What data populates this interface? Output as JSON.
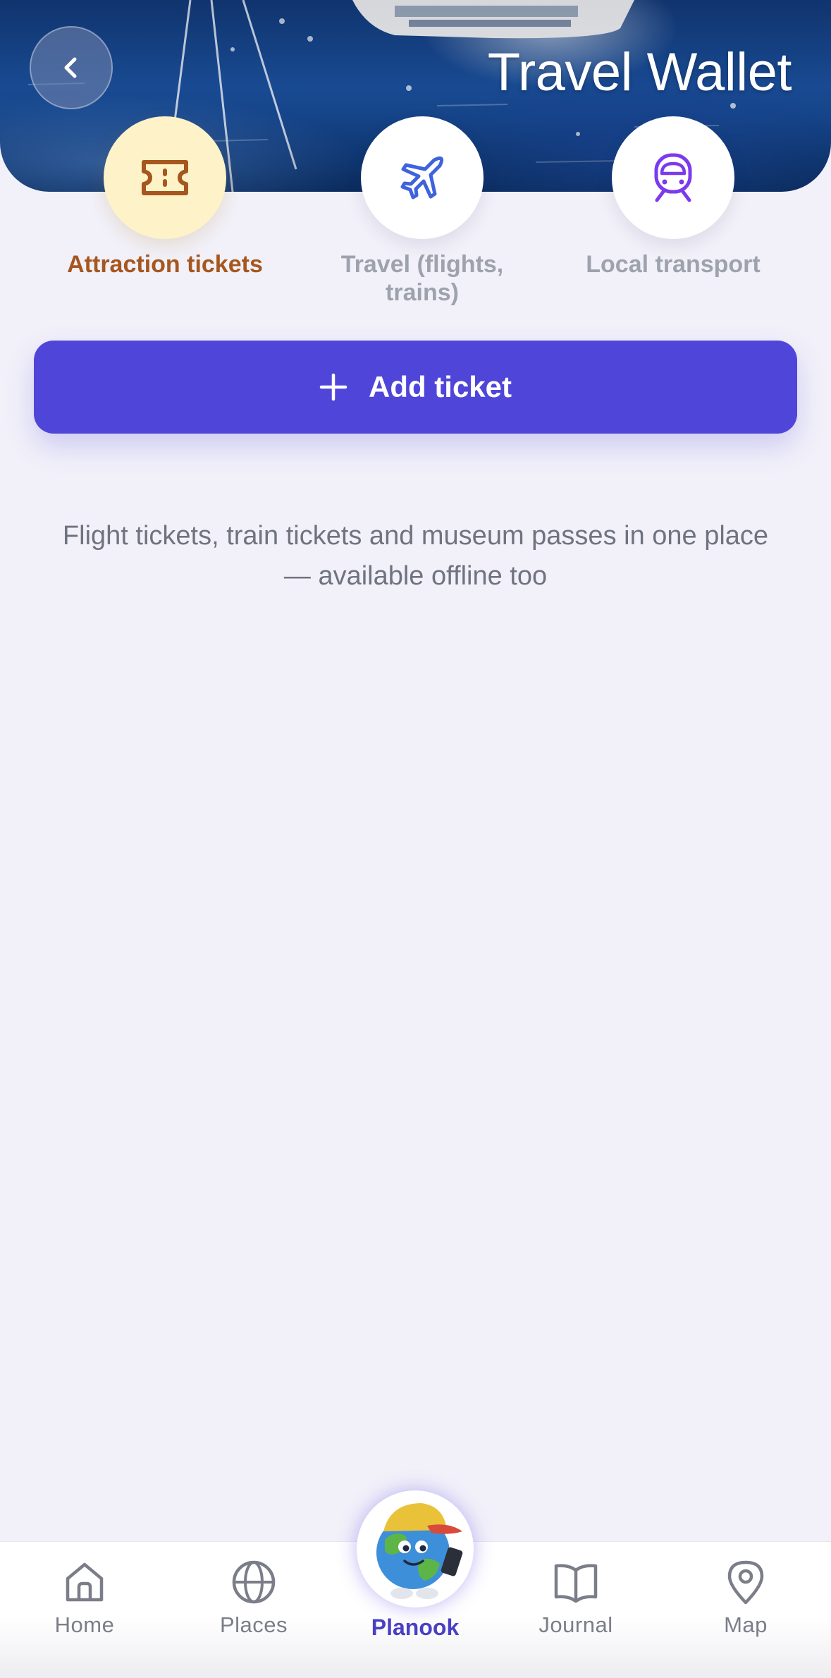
{
  "header": {
    "title": "Travel Wallet",
    "back_icon": "chevron-left-icon"
  },
  "categories": [
    {
      "label": "Attraction tickets",
      "icon": "ticket-icon",
      "active": true,
      "color": "#A6561E"
    },
    {
      "label": "Travel (flights, trains)",
      "icon": "airplane-icon",
      "active": false,
      "color": "#3E63DD"
    },
    {
      "label": "Local transport",
      "icon": "train-icon",
      "active": false,
      "color": "#7C3AED"
    }
  ],
  "actions": {
    "add_ticket_label": "Add ticket",
    "add_ticket_icon": "plus-icon"
  },
  "empty_state": {
    "message": "Flight tickets, train tickets and museum passes in one place — available offline too"
  },
  "bottom_nav": {
    "items": [
      {
        "label": "Home",
        "icon": "home-icon"
      },
      {
        "label": "Places",
        "icon": "globe-icon"
      },
      {
        "label": "Planook",
        "icon": "planook-mascot",
        "active": true
      },
      {
        "label": "Journal",
        "icon": "book-icon"
      },
      {
        "label": "Map",
        "icon": "map-pin-icon"
      }
    ]
  },
  "colors": {
    "accent": "#4F46D9",
    "background": "#F2F1F9",
    "active_category_bg": "#FEF3C8",
    "active_nav": "#4A3FC4"
  }
}
